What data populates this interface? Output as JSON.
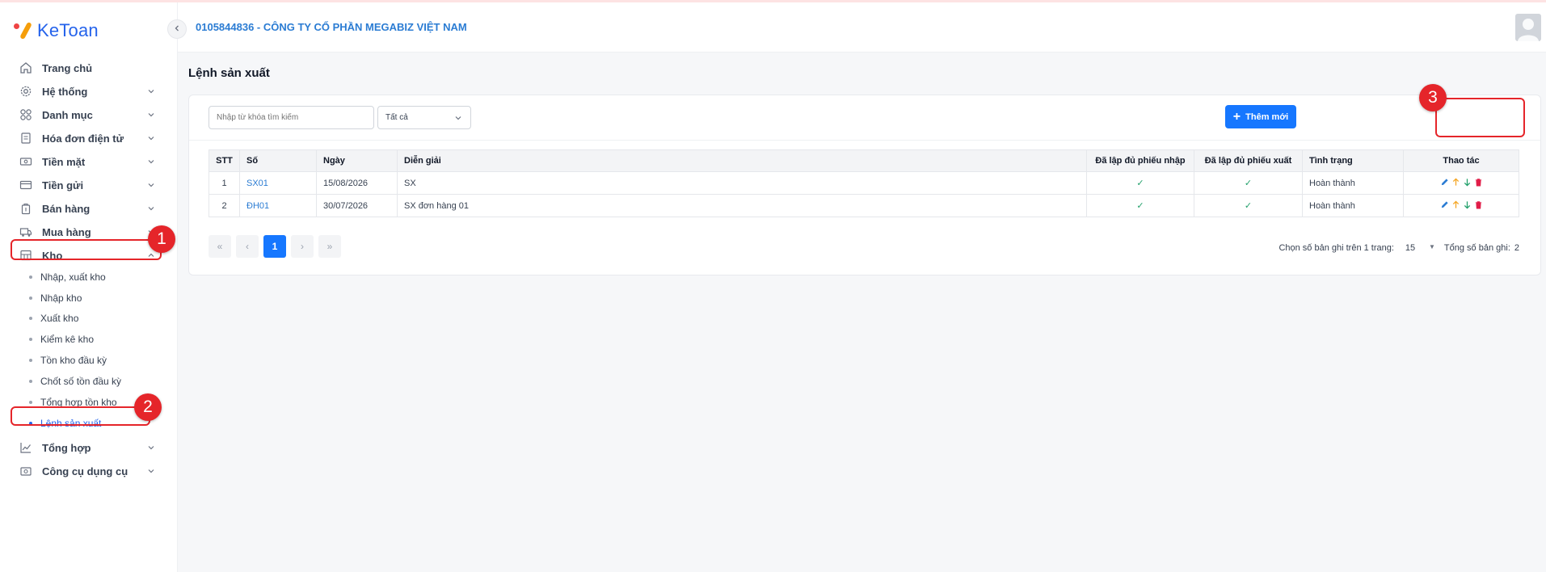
{
  "brand": {
    "logo_text": "KeToan"
  },
  "header": {
    "company": "0105844836 - CÔNG TY CỔ PHẦN MEGABIZ VIỆT NAM"
  },
  "sidebar": {
    "items": [
      {
        "label": "Trang chủ",
        "icon": "home-icon"
      },
      {
        "label": "Hệ thống",
        "icon": "gear-icon"
      },
      {
        "label": "Danh mục",
        "icon": "grid-icon"
      },
      {
        "label": "Hóa đơn điện tử",
        "icon": "invoice-icon"
      },
      {
        "label": "Tiền mặt",
        "icon": "cash-icon"
      },
      {
        "label": "Tiền gửi",
        "icon": "card-icon"
      },
      {
        "label": "Bán hàng",
        "icon": "sale-icon"
      },
      {
        "label": "Mua hàng",
        "icon": "truck-icon"
      },
      {
        "label": "Kho",
        "icon": "warehouse-icon"
      }
    ],
    "kho_sub": [
      {
        "label": "Nhập, xuất kho"
      },
      {
        "label": "Nhập kho"
      },
      {
        "label": "Xuất kho"
      },
      {
        "label": "Kiểm kê kho"
      },
      {
        "label": "Tồn kho đầu kỳ"
      },
      {
        "label": "Chốt số tồn đầu kỳ"
      },
      {
        "label": "Tổng hợp tồn kho"
      },
      {
        "label": "Lệnh sản xuất"
      }
    ],
    "items_after": [
      {
        "label": "Tổng hợp",
        "icon": "chart-icon"
      },
      {
        "label": "Công cụ dụng cụ",
        "icon": "tools-icon"
      }
    ]
  },
  "annotations": {
    "step1": "1",
    "step2": "2",
    "step3": "3"
  },
  "page": {
    "title": "Lệnh sản xuất"
  },
  "toolbar": {
    "search_placeholder": "Nhập từ khóa tìm kiếm",
    "filter_value": "Tất cả",
    "add_label": "Thêm mới"
  },
  "table": {
    "headers": [
      "STT",
      "Số",
      "Ngày",
      "Diễn giải",
      "Đã lập đủ phiếu nhập",
      "Đã lập đủ phiếu xuất",
      "Tình trạng",
      "Thao tác"
    ],
    "rows": [
      {
        "stt": "1",
        "so": "SX01",
        "ngay": "15/08/2026",
        "dien_giai": "SX",
        "status": "Hoàn thành"
      },
      {
        "stt": "2",
        "so": "ĐH01",
        "ngay": "30/07/2026",
        "dien_giai": "SX đơn hàng 01",
        "status": "Hoàn thành"
      }
    ]
  },
  "pagination": {
    "current_page": "1",
    "per_page_label": "Chọn số bản ghi trên 1 trang:",
    "per_page": "15",
    "total_label": "Tổng số bản ghi:",
    "total": "2"
  },
  "colors": {
    "accent": "#1677ff",
    "annotation": "#e5252a",
    "link": "#2b7cd3",
    "check": "#22a06b"
  }
}
